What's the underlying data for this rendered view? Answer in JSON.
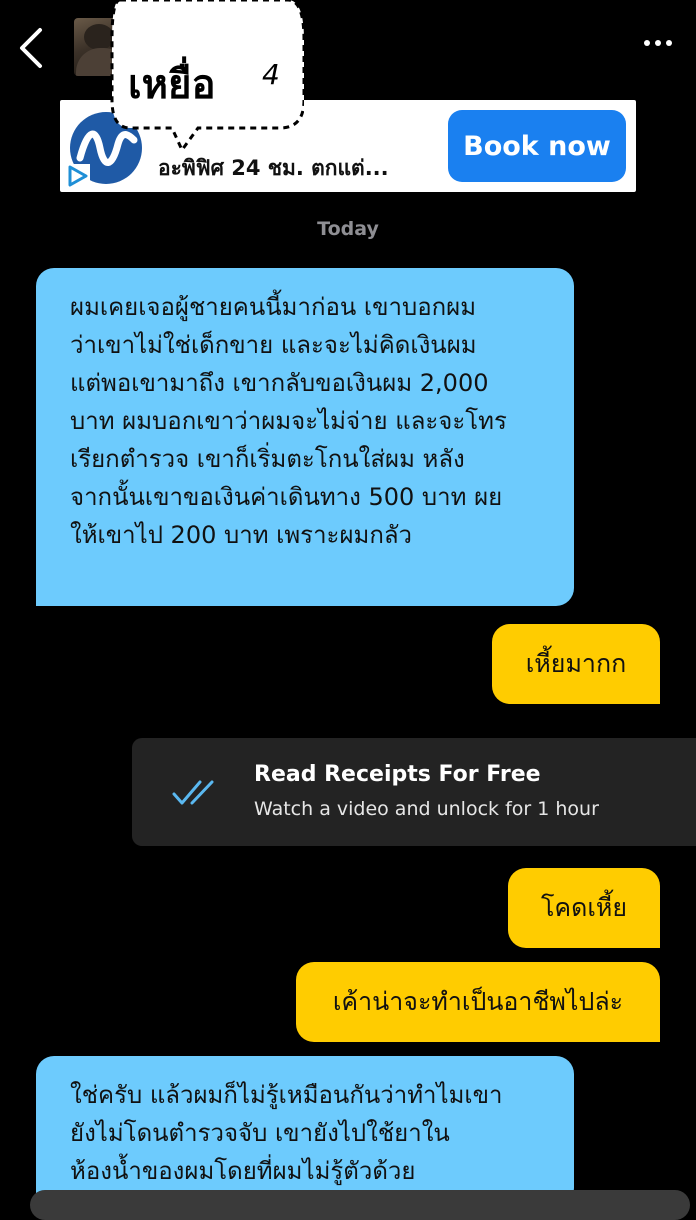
{
  "header": {
    "back_icon": "chevron-left-icon",
    "more_icon": "more-dots-icon",
    "contact_name": "เหยื่อ",
    "name_suffix_mark": "4"
  },
  "ad": {
    "text": "อะพิฟิศ 24 ชม. ตกแต่...",
    "button_label": "Book now",
    "accent_color": "#1a80f0"
  },
  "chat": {
    "date_label": "Today",
    "messages": [
      {
        "direction": "incoming",
        "lines": [
          "ผมเคยเจอผู้ชายคนนี้มาก่อน เขาบอกผม",
          "ว่าเขาไม่ใช่เด็กขาย และจะไม่คิดเงินผม",
          "แต่พอเขามาถึง เขากลับขอเงินผม 2,000",
          "บาท ผมบอกเขาว่าผมจะไม่จ่าย และจะโทร",
          "เรียกตำรวจ เขาก็เริ่มตะโกนใส่ผม หลัง",
          "จากนั้นเขาขอเงินค่าเดินทาง 500 บาท ผย",
          "ให้เขาไป 200 บาท เพราะผมกลัว"
        ]
      },
      {
        "direction": "outgoing",
        "text": "เหี้ยมากก"
      },
      {
        "direction": "outgoing",
        "text": "โคดเหี้ย"
      },
      {
        "direction": "outgoing",
        "text": "เค้าน่าจะทำเป็นอาชีพไปล่ะ"
      },
      {
        "direction": "incoming",
        "lines": [
          "ใช่ครับ แล้วผมก็ไม่รู้เหมือนกันว่าทำไมเขา",
          "ยังไม่โดนตำรวจจับ เขายังไปใช้ยาใน",
          "ห้องน้ำของผมโดยที่ผมไม่รู้ตัวด้วย"
        ]
      }
    ],
    "incoming_color": "#6dcbfd",
    "outgoing_color": "#ffcc00"
  },
  "read_receipts": {
    "title": "Read Receipts For Free",
    "subtitle": "Watch a video and unlock for 1 hour",
    "icon": "double-check-icon",
    "icon_color": "#5ab8f0"
  }
}
